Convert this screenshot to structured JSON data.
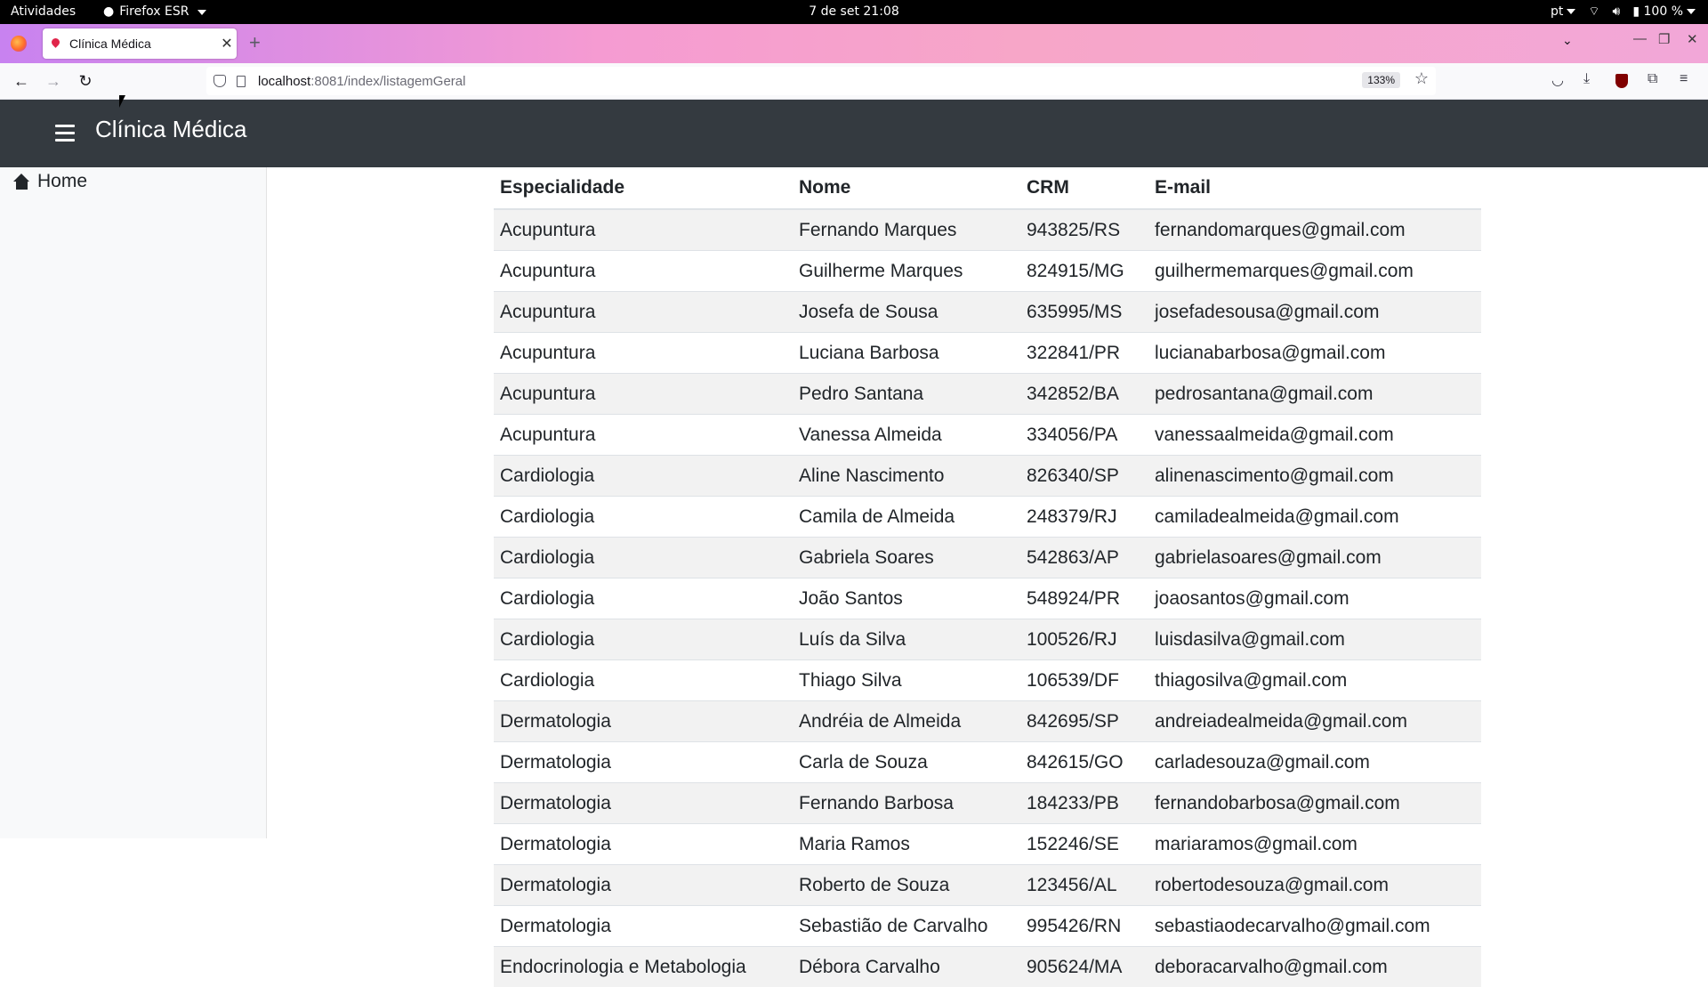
{
  "system": {
    "activities": "Atividades",
    "app_name": "Firefox ESR",
    "clock": "7 de set  21:08",
    "language": "pt",
    "battery": "100 %"
  },
  "browser": {
    "tab_title": "Clínica Médica",
    "url_host": "localhost",
    "url_path": ":8081/index/listagemGeral",
    "zoom": "133%"
  },
  "header": {
    "brand": "Clínica Médica"
  },
  "sidebar": {
    "items": [
      {
        "label": "Home",
        "icon": "home-icon"
      }
    ]
  },
  "table": {
    "columns": [
      "Especialidade",
      "Nome",
      "CRM",
      "E-mail"
    ],
    "rows": [
      [
        "Acupuntura",
        "Fernando Marques",
        "943825/RS",
        "fernandomarques@gmail.com"
      ],
      [
        "Acupuntura",
        "Guilherme Marques",
        "824915/MG",
        "guilhermemarques@gmail.com"
      ],
      [
        "Acupuntura",
        "Josefa de Sousa",
        "635995/MS",
        "josefadesousa@gmail.com"
      ],
      [
        "Acupuntura",
        "Luciana Barbosa",
        "322841/PR",
        "lucianabarbosa@gmail.com"
      ],
      [
        "Acupuntura",
        "Pedro Santana",
        "342852/BA",
        "pedrosantana@gmail.com"
      ],
      [
        "Acupuntura",
        "Vanessa Almeida",
        "334056/PA",
        "vanessaalmeida@gmail.com"
      ],
      [
        "Cardiologia",
        "Aline Nascimento",
        "826340/SP",
        "alinenascimento@gmail.com"
      ],
      [
        "Cardiologia",
        "Camila de Almeida",
        "248379/RJ",
        "camiladealmeida@gmail.com"
      ],
      [
        "Cardiologia",
        "Gabriela Soares",
        "542863/AP",
        "gabrielasoares@gmail.com"
      ],
      [
        "Cardiologia",
        "João Santos",
        "548924/PR",
        "joaosantos@gmail.com"
      ],
      [
        "Cardiologia",
        "Luís da Silva",
        "100526/RJ",
        "luisdasilva@gmail.com"
      ],
      [
        "Cardiologia",
        "Thiago Silva",
        "106539/DF",
        "thiagosilva@gmail.com"
      ],
      [
        "Dermatologia",
        "Andréia de Almeida",
        "842695/SP",
        "andreiadealmeida@gmail.com"
      ],
      [
        "Dermatologia",
        "Carla de Souza",
        "842615/GO",
        "carladesouza@gmail.com"
      ],
      [
        "Dermatologia",
        "Fernando Barbosa",
        "184233/PB",
        "fernandobarbosa@gmail.com"
      ],
      [
        "Dermatologia",
        "Maria Ramos",
        "152246/SE",
        "mariaramos@gmail.com"
      ],
      [
        "Dermatologia",
        "Roberto de Souza",
        "123456/AL",
        "robertodesouza@gmail.com"
      ],
      [
        "Dermatologia",
        "Sebastião de Carvalho",
        "995426/RN",
        "sebastiaodecarvalho@gmail.com"
      ],
      [
        "Endocrinologia e Metabologia",
        "Débora Carvalho",
        "905624/MA",
        "deboracarvalho@gmail.com"
      ]
    ]
  }
}
